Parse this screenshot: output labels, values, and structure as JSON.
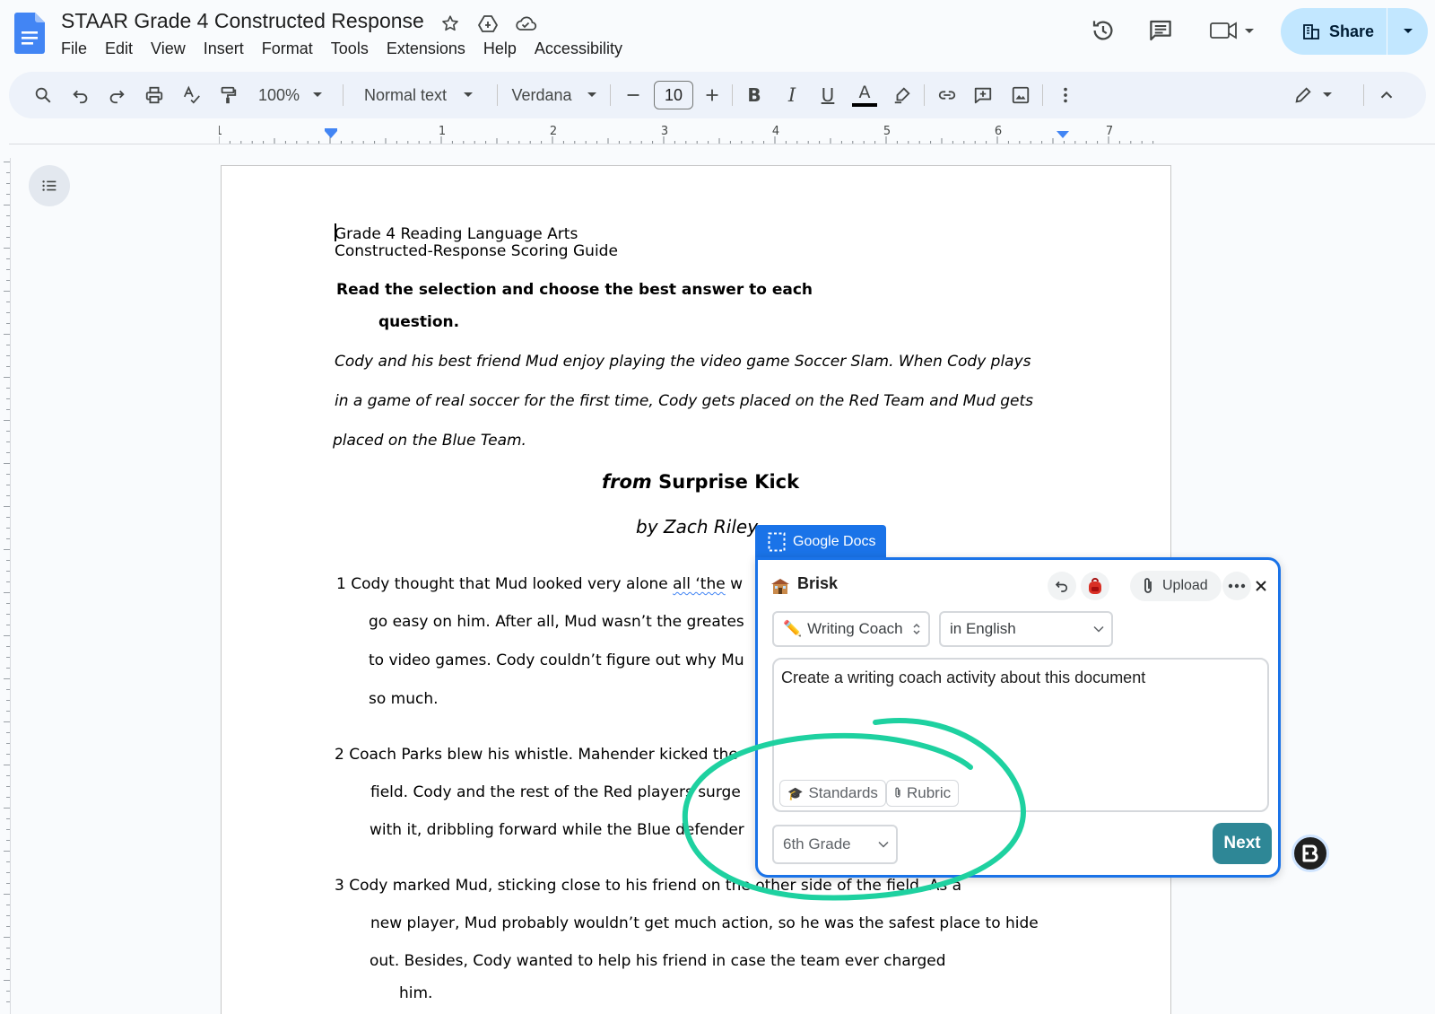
{
  "app": {
    "doc_title": "STAAR Grade 4 Constructed Response",
    "menu": [
      "File",
      "Edit",
      "View",
      "Insert",
      "Format",
      "Tools",
      "Extensions",
      "Help",
      "Accessibility"
    ],
    "share_label": "Share"
  },
  "toolbar": {
    "zoom": "100%",
    "style": "Normal text",
    "font": "Verdana",
    "font_size": "10"
  },
  "ruler": {
    "labels": [
      "1",
      "1",
      "2",
      "3",
      "4",
      "5",
      "6",
      "7"
    ]
  },
  "document": {
    "line1": "Grade 4 Reading Language Arts",
    "line2": "Constructed-Response Scoring Guide",
    "instruction_1": "Read the selection and choose the best answer to each",
    "instruction_2": "question.",
    "intro_1": "Cody and his best friend Mud enjoy playing the video game Soccer Slam. When Cody plays",
    "intro_2": "in a game of real soccer for the first time, Cody gets placed on the Red Team and Mud gets",
    "intro_3": "placed on the Blue Team.",
    "heading_from": "from",
    "heading_title": "Surprise Kick",
    "byline": "by Zach Riley",
    "p1_prefix": "1 Cody thought that Mud looked very alone ",
    "p1_squiggle": "all ‘the",
    "p1_suffix": " w",
    "p1_l2": "go easy on him. After all, Mud wasn’t the greates",
    "p1_l3": "to video games. Cody couldn’t figure out why Mu",
    "p1_l4": "so much.",
    "p2_l1": "2 Coach Parks blew his whistle. Mahender kicked the",
    "p2_l2": "field. Cody and the rest of the Red players surge",
    "p2_l3": "with it, dribbling forward while the Blue defender",
    "p3_l1": "3 Cody marked Mud, sticking close to his friend on the other side of the field. As a",
    "p3_l2": "new player, Mud probably wouldn’t get much action, so he was the safest place to hide",
    "p3_l3": "out. Besides, Cody wanted to help his friend in case the team ever charged",
    "p3_l4": "him."
  },
  "brisk": {
    "tab_label": "Google Docs",
    "name": "Brisk",
    "upload_label": "Upload",
    "tool_select": "Writing Coach",
    "language_select": "in English",
    "prompt": "Create a writing coach activity about this document",
    "chip_standards": "Standards",
    "chip_rubric": "Rubric",
    "grade_select": "6th Grade",
    "next_label": "Next",
    "accent": "#2e8796",
    "frame_color": "#1a73e8"
  },
  "annotation": {
    "color": "#1ed1a0"
  }
}
